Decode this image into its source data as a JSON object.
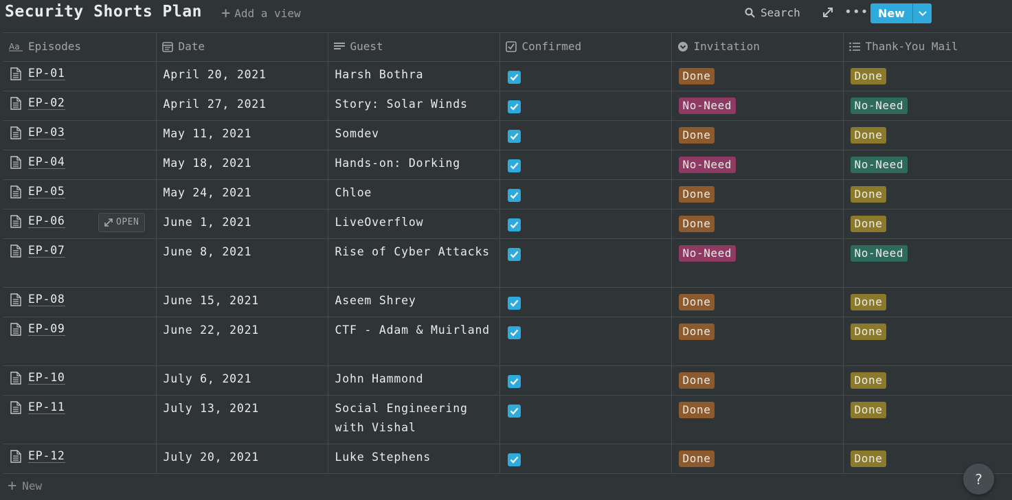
{
  "header": {
    "title": "Security Shorts Plan",
    "add_view": "Add a view",
    "search": "Search",
    "new_label": "New"
  },
  "columns": [
    {
      "label": "Episodes",
      "icon": "title-icon"
    },
    {
      "label": "Date",
      "icon": "calendar-icon"
    },
    {
      "label": "Guest",
      "icon": "text-icon"
    },
    {
      "label": "Confirmed",
      "icon": "checkbox-icon"
    },
    {
      "label": "Invitation",
      "icon": "select-icon"
    },
    {
      "label": "Thank-You Mail",
      "icon": "list-icon"
    }
  ],
  "rows": [
    {
      "episode": "EP-01",
      "date": "April 20, 2021",
      "guest": "Harsh Bothra",
      "confirmed": true,
      "invitation": "Done",
      "thankyou": "Done"
    },
    {
      "episode": "EP-02",
      "date": "April 27, 2021",
      "guest": "Story: Solar Winds",
      "confirmed": true,
      "invitation": "No-Need",
      "thankyou": "No-Need"
    },
    {
      "episode": "EP-03",
      "date": "May 11, 2021",
      "guest": "Somdev",
      "confirmed": true,
      "invitation": "Done",
      "thankyou": "Done"
    },
    {
      "episode": "EP-04",
      "date": "May 18, 2021",
      "guest": "Hands-on: Dorking",
      "confirmed": true,
      "invitation": "No-Need",
      "thankyou": "No-Need"
    },
    {
      "episode": "EP-05",
      "date": "May 24, 2021",
      "guest": "Chloe",
      "confirmed": true,
      "invitation": "Done",
      "thankyou": "Done"
    },
    {
      "episode": "EP-06",
      "date": "June 1, 2021",
      "guest": "LiveOverflow",
      "confirmed": true,
      "invitation": "Done",
      "thankyou": "Done",
      "open_label": "OPEN"
    },
    {
      "episode": "EP-07",
      "date": "June 8, 2021",
      "guest": "Rise of Cyber Attacks",
      "confirmed": true,
      "invitation": "No-Need",
      "thankyou": "No-Need"
    },
    {
      "episode": "EP-08",
      "date": "June 15, 2021",
      "guest": "Aseem Shrey",
      "confirmed": true,
      "invitation": "Done",
      "thankyou": "Done"
    },
    {
      "episode": "EP-09",
      "date": "June 22, 2021",
      "guest": "CTF - Adam & Muirland",
      "confirmed": true,
      "invitation": "Done",
      "thankyou": "Done"
    },
    {
      "episode": "EP-10",
      "date": "July 6, 2021",
      "guest": "John Hammond",
      "confirmed": true,
      "invitation": "Done",
      "thankyou": "Done"
    },
    {
      "episode": "EP-11",
      "date": "July 13, 2021",
      "guest": "Social Engineering with Vishal",
      "confirmed": true,
      "invitation": "Done",
      "thankyou": "Done"
    },
    {
      "episode": "EP-12",
      "date": "July 20, 2021",
      "guest": "Luke Stephens",
      "confirmed": true,
      "invitation": "Done",
      "thankyou": "Done"
    }
  ],
  "footer": {
    "new_row": "New",
    "help": "?"
  },
  "colors": {
    "background": "#2f3437",
    "accent": "#2eaadc",
    "invitation_done": "#8d5a2e",
    "invitation_noneed": "#8e3a63",
    "thankyou_done": "#8b7a2c",
    "thankyou_noneed": "#2e6b5c"
  }
}
